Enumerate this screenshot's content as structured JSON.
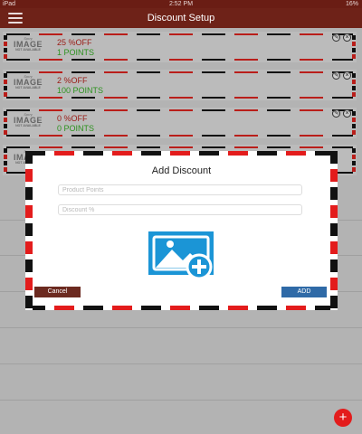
{
  "status_bar": {
    "device": "iPad",
    "time": "2:52 PM",
    "battery": "16%"
  },
  "header": {
    "title": "Discount Setup",
    "menu_icon": "hamburger-menu-icon"
  },
  "placeholder_image": {
    "line1": "Sorry",
    "line2": "IMAGE",
    "line3": "NOT AVAILABLE"
  },
  "discounts": [
    {
      "percent": "25 %OFF",
      "points": "1 POINTS"
    },
    {
      "percent": "2 %OFF",
      "points": "100 POINTS"
    },
    {
      "percent": "0 %OFF",
      "points": "0 POINTS"
    }
  ],
  "modal": {
    "title": "Add Discount",
    "product_points": {
      "placeholder": "Product Points",
      "value": ""
    },
    "discount": {
      "placeholder": "Discount %",
      "value": ""
    },
    "image_icon": "add-image-icon",
    "cancel_label": "Cancel",
    "add_label": "ADD"
  },
  "fab": {
    "label": "+",
    "icon": "plus-icon"
  },
  "colors": {
    "header": "#6e2218",
    "percent_text": "#a31e18",
    "points_text": "#2e9a1f",
    "cancel_button": "#6c2a20",
    "add_button": "#2f6aa7",
    "fab": "#e31c1c"
  }
}
